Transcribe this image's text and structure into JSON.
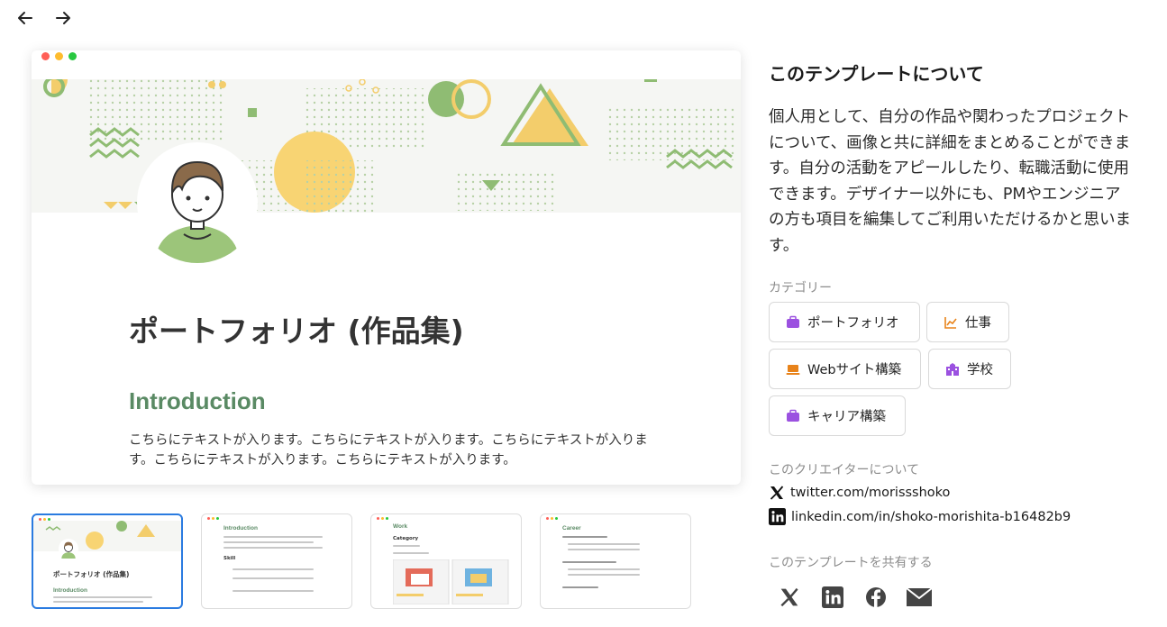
{
  "nav": {
    "back_icon": "arrow-left-icon",
    "forward_icon": "arrow-right-icon"
  },
  "preview": {
    "title": "ポートフォリオ (作品集)",
    "heading": "Introduction",
    "body": "こちらにテキストが入ります。こちらにテキストが入ります。こちらにテキストが入ります。こちらにテキストが入ります。こちらにテキストが入ります。",
    "window_dot_colors": [
      "#ff5f57",
      "#febc2e",
      "#28c840"
    ]
  },
  "thumbnails": [
    {
      "title": "ポートフォリオ (作品集)",
      "heading": "Introduction"
    },
    {
      "heading": "Introduction",
      "sub": "Skill"
    },
    {
      "heading": "Work",
      "sub": "Category"
    },
    {
      "heading": "Career"
    }
  ],
  "about": {
    "title": "このテンプレートについて",
    "description": "個人用として、自分の作品や関わったプロジェクトについて、画像と共に詳細をまとめることができます。自分の活動をアピールしたり、転職活動に使用できます。デザイナー以外にも、PMやエンジニアの方も項目を編集してご利用いただけるかと思います。"
  },
  "categories": {
    "label": "カテゴリー",
    "items": [
      {
        "label": "ポートフォリオ",
        "icon": "briefcase-icon",
        "color": "#9b51e0"
      },
      {
        "label": "仕事",
        "icon": "chart-icon",
        "color": "#e8831a"
      },
      {
        "label": "Webサイト構築",
        "icon": "laptop-icon",
        "color": "#e8831a"
      },
      {
        "label": "学校",
        "icon": "school-icon",
        "color": "#9b51e0"
      },
      {
        "label": "キャリア構築",
        "icon": "briefcase-icon",
        "color": "#9b51e0"
      }
    ]
  },
  "creator": {
    "label": "このクリエイターについて",
    "links": [
      {
        "label": "twitter.com/morissshoko",
        "icon": "x-icon"
      },
      {
        "label": "linkedin.com/in/shoko-morishita-b16482b9",
        "icon": "linkedin-icon"
      }
    ]
  },
  "share": {
    "label": "このテンプレートを共有する",
    "buttons": [
      "x-icon",
      "linkedin-icon",
      "facebook-icon",
      "mail-icon"
    ]
  }
}
